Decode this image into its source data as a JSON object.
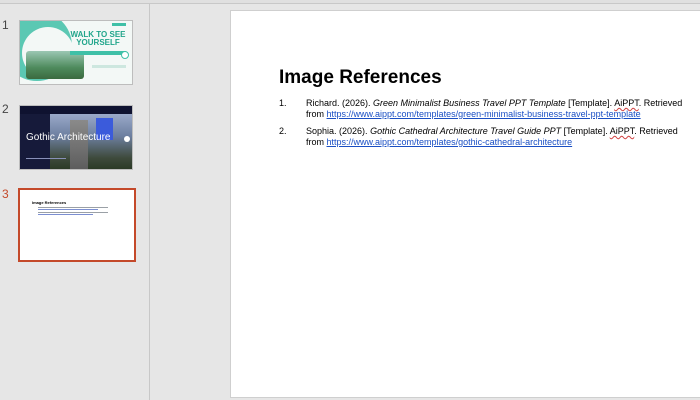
{
  "thumbnails": [
    {
      "number": "1",
      "title": "WALK TO SEE YOURSELF",
      "active": false
    },
    {
      "number": "2",
      "title": "Gothic Architecture",
      "active": false
    },
    {
      "number": "3",
      "title": "Image References",
      "active": true
    }
  ],
  "slide": {
    "title": "Image References",
    "references": [
      {
        "number": "1.",
        "author": "Richard. (2026).",
        "work": "Green Minimalist Business Travel PPT Template",
        "type": "[Template].",
        "publisher": "AiPPT",
        "retrieved": ". Retrieved",
        "from": "from",
        "url": "https://www.aippt.com/templates/green-minimalist-business-travel-ppt-template"
      },
      {
        "number": "2.",
        "author": "Sophia. (2026).",
        "work": "Gothic Cathedral Architecture Travel Guide PPT",
        "type": "[Template].",
        "publisher": "AiPPT",
        "retrieved": ". Retrieved",
        "from": "from",
        "url": "https://www.aippt.com/templates/gothic-cathedral-architecture"
      }
    ]
  },
  "colors": {
    "accent_active": "#c4492a",
    "link": "#1a4fc4",
    "thumb1_green": "#3fc0a7",
    "thumb2_navy": "#161a3a"
  }
}
